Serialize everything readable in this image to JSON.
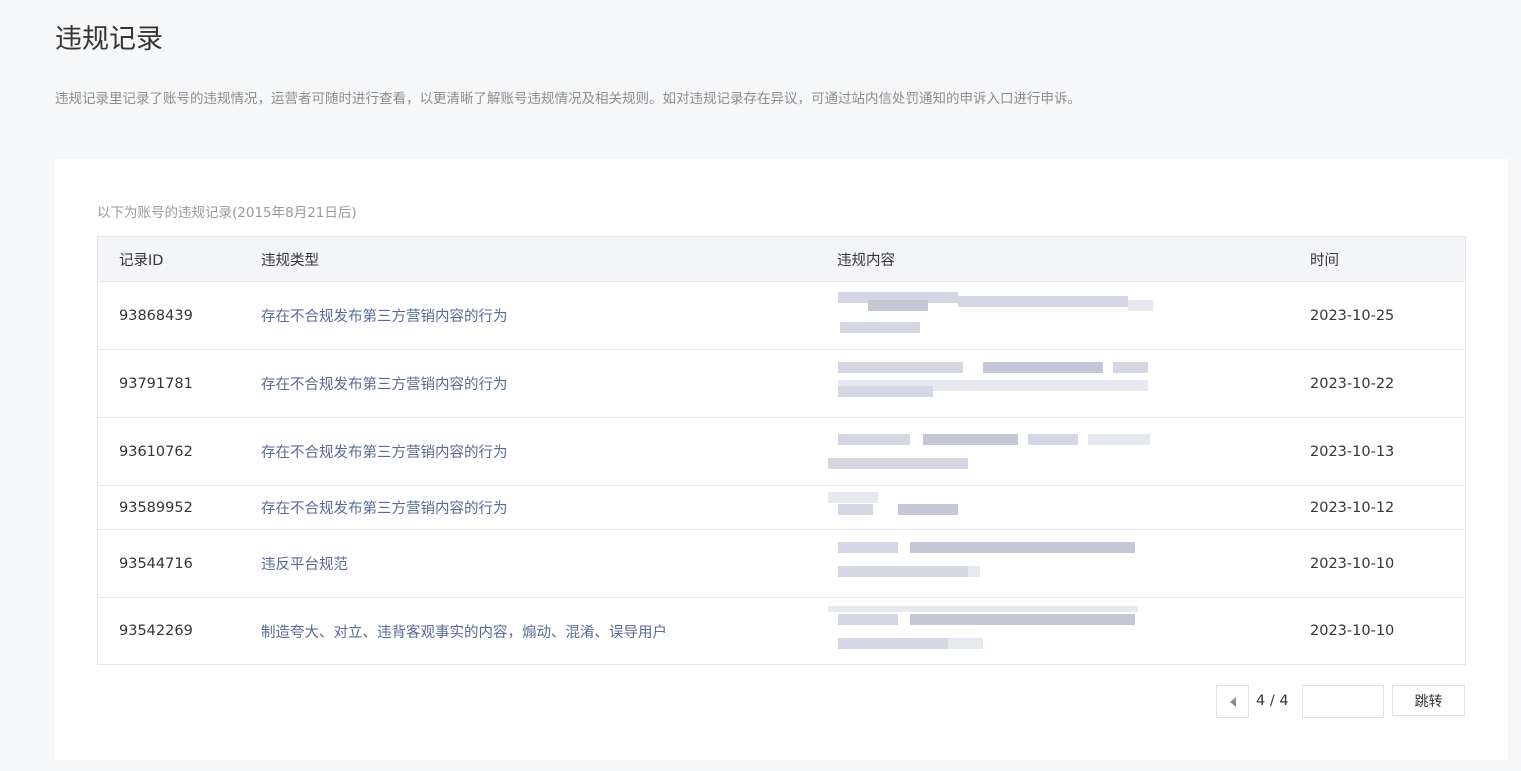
{
  "page": {
    "title": "违规记录",
    "description": "违规记录里记录了账号的违规情况，运营者可随时进行查看，以更清晰了解账号违规情况及相关规则。如对违规记录存在异议，可通过站内信处罚通知的申诉入口进行申诉。"
  },
  "table": {
    "caption": "以下为账号的违规记录(2015年8月21日后)",
    "columns": [
      "记录ID",
      "违规类型",
      "违规内容",
      "时间"
    ],
    "rows": [
      {
        "id": "93868439",
        "type": "存在不合规发布第三方营销内容的行为",
        "time": "2023-10-25"
      },
      {
        "id": "93791781",
        "type": "存在不合规发布第三方营销内容的行为",
        "time": "2023-10-22"
      },
      {
        "id": "93610762",
        "type": "存在不合规发布第三方营销内容的行为",
        "time": "2023-10-13"
      },
      {
        "id": "93589952",
        "type": "存在不合规发布第三方营销内容的行为",
        "time": "2023-10-12"
      },
      {
        "id": "93544716",
        "type": "违反平台规范",
        "time": "2023-10-10"
      },
      {
        "id": "93542269",
        "type": "制造夸大、对立、违背客观事实的内容，煽动、混淆、误导用户",
        "time": "2023-10-10"
      }
    ]
  },
  "pager": {
    "page_text": "4 / 4",
    "jump_input_value": "",
    "jump_label": "跳转",
    "prev_icon": "caret-left-icon"
  },
  "colors": {
    "background": "#f6f7f9",
    "card": "#ffffff",
    "link_text": "#576b95",
    "header_row": "#f4f5f9",
    "border": "#e7e7eb"
  }
}
